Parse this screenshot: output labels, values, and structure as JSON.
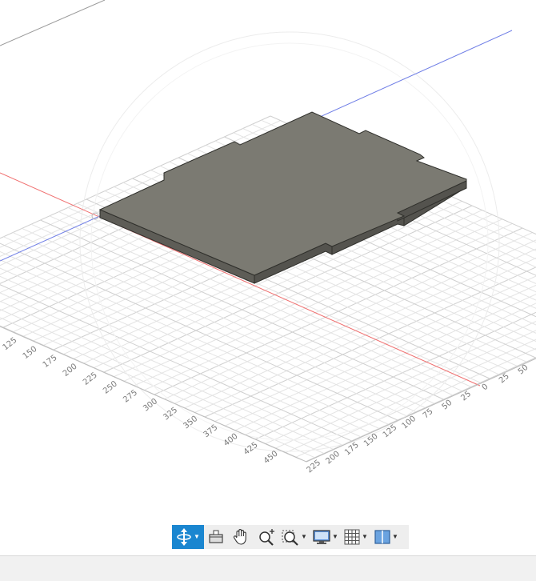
{
  "viewport": {
    "axis_labels_left": [
      "125",
      "150",
      "175",
      "200",
      "225",
      "250",
      "275",
      "300",
      "325",
      "350",
      "375",
      "400",
      "425",
      "450"
    ],
    "axis_labels_right": [
      "225",
      "200",
      "175",
      "150",
      "125",
      "100",
      "75",
      "50",
      "25",
      "0",
      "25",
      "50"
    ],
    "colors": {
      "background": "#ffffff",
      "grid": "#e3e3e3",
      "grid_major": "#cfcfcf",
      "x_axis": "#f07070",
      "y_axis": "#6f7ee6",
      "plate_top": "#7b7a72",
      "plate_side": "#5e5d57",
      "plate_edge": "#2f2f2b"
    }
  },
  "toolbar": {
    "items": [
      {
        "name": "orbit",
        "icon": "orbit-icon",
        "has_dropdown": true,
        "active": true
      },
      {
        "name": "look-at",
        "icon": "look-at-icon",
        "has_dropdown": false,
        "active": false
      },
      {
        "name": "pan",
        "icon": "hand-icon",
        "has_dropdown": false,
        "active": false
      },
      {
        "name": "zoom",
        "icon": "zoom-icon",
        "has_dropdown": false,
        "active": false
      },
      {
        "name": "fit",
        "icon": "zoom-window-icon",
        "has_dropdown": true,
        "active": false
      },
      {
        "name": "display-settings",
        "icon": "monitor-icon",
        "has_dropdown": true,
        "active": false
      },
      {
        "name": "grid-settings",
        "icon": "grid-icon",
        "has_dropdown": true,
        "active": false
      },
      {
        "name": "viewports",
        "icon": "viewports-icon",
        "has_dropdown": true,
        "active": false
      }
    ]
  }
}
